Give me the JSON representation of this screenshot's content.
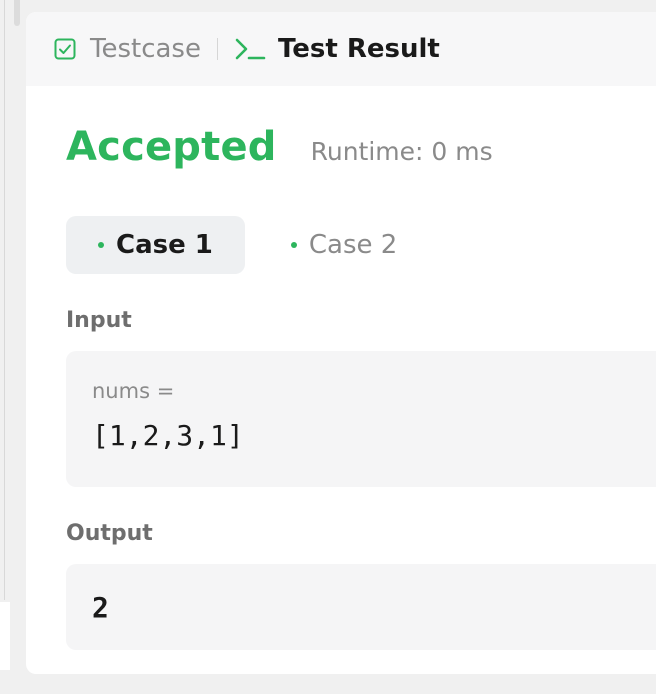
{
  "tabs": {
    "testcase_label": "Testcase",
    "result_label": "Test Result"
  },
  "result": {
    "status": "Accepted",
    "runtime": "Runtime: 0 ms"
  },
  "cases": [
    {
      "label": "Case 1",
      "active": true
    },
    {
      "label": "Case 2",
      "active": false
    }
  ],
  "input": {
    "label": "Input",
    "var_name": "nums =",
    "value": "[1,2,3,1]"
  },
  "output": {
    "label": "Output",
    "value": "2"
  },
  "colors": {
    "accepted": "#2db55d",
    "muted_text": "#8a8a8a",
    "field_bg": "#f5f5f6",
    "active_case_bg": "#eef0f2"
  },
  "icons": {
    "testcase": "checkbox-check-icon",
    "result": "terminal-prompt-icon",
    "case_dot": "dot-icon"
  }
}
